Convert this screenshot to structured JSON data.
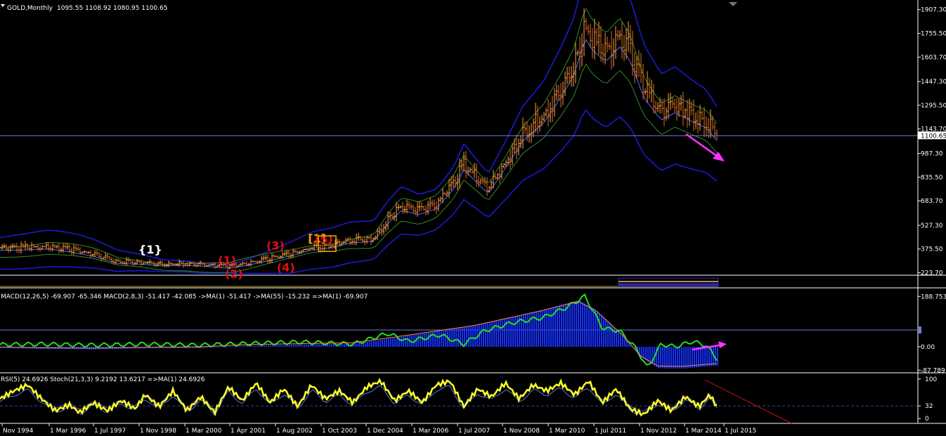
{
  "header": {
    "symbol": "GOLD,Monthly",
    "ohlc": "1095.55 1108.92 1080.95 1100.65"
  },
  "colors": {
    "background": "#000000",
    "grid": "#ffffff",
    "candle_up": "#ffa040",
    "candle_down": "#e07020",
    "band_outer": "#1a1ad0",
    "band_inner": "#2e8b2e",
    "ma_line": "#4a6cff",
    "current_price_line": "#6c7cd8",
    "arrow": "#ff33ff",
    "macd_hist": "#1530ff",
    "macd_line": "#22e022",
    "rsi_line": "#ffff22",
    "stoch_line": "#7a5cc8",
    "wave_red": "#e01010",
    "wave_orange": "#ffa500",
    "wave_white": "#ffffff",
    "trendline": "#c01010"
  },
  "chart_data": [
    {
      "type": "ohlc",
      "title": "GOLD,Monthly",
      "x_ticks": [
        "Nov 1994",
        "1 Mar 1996",
        "1 Jul 1997",
        "1 Nov 1998",
        "1 Mar 2000",
        "1 Apr 2001",
        "1 Aug 2002",
        "1 Oct 2003",
        "1 Dec 2004",
        "1 Mar 2006",
        "1 Jul 2007",
        "1 Nov 2008",
        "1 Mar 2010",
        "1 Jul 2011",
        "1 Nov 2012",
        "1 Mar 2014",
        "1 Jul 2015"
      ],
      "y_ticks": [
        1907.3,
        1755.5,
        1603.7,
        1447.3,
        1295.5,
        1143.7,
        987.3,
        835.5,
        683.7,
        527.3,
        375.5,
        223.7
      ],
      "y_tick_labels": [
        "1907.30",
        "1755.50",
        "1603.70",
        "1447.30",
        "1295.50",
        "1143.70",
        "987.30",
        "835.50",
        "683.70",
        "527.30",
        "375.50",
        "223.70"
      ],
      "ylim": [
        208,
        1942
      ],
      "current_price": 1100.65,
      "current_price_label": "1100.65",
      "price_series": [
        [
          1994.8,
          383
        ],
        [
          1995.5,
          385
        ],
        [
          1996.2,
          392
        ],
        [
          1996.9,
          370
        ],
        [
          1997.5,
          342
        ],
        [
          1998.2,
          295
        ],
        [
          1998.9,
          290
        ],
        [
          1999.5,
          278
        ],
        [
          2000.2,
          283
        ],
        [
          2000.9,
          272
        ],
        [
          2001.4,
          262
        ],
        [
          2002.0,
          285
        ],
        [
          2002.6,
          315
        ],
        [
          2003.2,
          345
        ],
        [
          2003.8,
          385
        ],
        [
          2004.4,
          400
        ],
        [
          2004.9,
          430
        ],
        [
          2005.6,
          445
        ],
        [
          2006.0,
          560
        ],
        [
          2006.4,
          650
        ],
        [
          2006.9,
          620
        ],
        [
          2007.4,
          660
        ],
        [
          2007.9,
          790
        ],
        [
          2008.2,
          920
        ],
        [
          2008.6,
          830
        ],
        [
          2008.9,
          760
        ],
        [
          2009.4,
          930
        ],
        [
          2009.9,
          1110
        ],
        [
          2010.5,
          1230
        ],
        [
          2011.0,
          1400
        ],
        [
          2011.4,
          1560
        ],
        [
          2011.7,
          1800
        ],
        [
          2011.9,
          1720
        ],
        [
          2012.3,
          1640
        ],
        [
          2012.7,
          1740
        ],
        [
          2013.0,
          1650
        ],
        [
          2013.4,
          1400
        ],
        [
          2013.9,
          1250
        ],
        [
          2014.3,
          1300
        ],
        [
          2014.8,
          1240
        ],
        [
          2015.2,
          1200
        ],
        [
          2015.55,
          1100.65
        ]
      ]
    },
    {
      "type": "line",
      "title": "MACD(12,26,5) -69.907 -65.346  MACD(2,8,3) -51.417 -42.085  ->MA(1) -51.417  ->MA(55) -15.232  =>MA(1) -69.907",
      "y_ticks": [
        188.753,
        0.0,
        -87.789
      ],
      "y_tick_labels": [
        "188.753",
        "0.00",
        "-87.789"
      ],
      "ylim": [
        -95,
        200
      ],
      "histogram": [
        [
          1994.8,
          -5
        ],
        [
          1996.0,
          -8
        ],
        [
          1997.5,
          -10
        ],
        [
          1999.0,
          -6
        ],
        [
          2000.5,
          -5
        ],
        [
          2002.0,
          5
        ],
        [
          2003.5,
          8
        ],
        [
          2005.0,
          12
        ],
        [
          2006.5,
          40
        ],
        [
          2007.5,
          60
        ],
        [
          2008.5,
          80
        ],
        [
          2009.5,
          110
        ],
        [
          2010.5,
          140
        ],
        [
          2011.5,
          175
        ],
        [
          2012.0,
          140
        ],
        [
          2012.8,
          40
        ],
        [
          2013.3,
          -40
        ],
        [
          2013.8,
          -80
        ],
        [
          2014.5,
          -82
        ],
        [
          2015.55,
          -70
        ]
      ],
      "signal_line": [
        [
          1994.8,
          8
        ],
        [
          1996.0,
          10
        ],
        [
          1997.5,
          6
        ],
        [
          1999.0,
          10
        ],
        [
          2000.5,
          6
        ],
        [
          2002.0,
          12
        ],
        [
          2003.5,
          18
        ],
        [
          2005.0,
          10
        ],
        [
          2006.0,
          50
        ],
        [
          2006.6,
          20
        ],
        [
          2007.5,
          45
        ],
        [
          2008.2,
          10
        ],
        [
          2008.8,
          60
        ],
        [
          2009.6,
          90
        ],
        [
          2010.5,
          110
        ],
        [
          2011.2,
          150
        ],
        [
          2011.7,
          190
        ],
        [
          2012.2,
          70
        ],
        [
          2012.7,
          60
        ],
        [
          2013.2,
          -10
        ],
        [
          2013.5,
          -80
        ],
        [
          2013.9,
          10
        ],
        [
          2014.3,
          0
        ],
        [
          2014.8,
          20
        ],
        [
          2015.2,
          5
        ],
        [
          2015.55,
          -51.417
        ]
      ]
    },
    {
      "type": "line",
      "title": "RSI(5) 24.6926  Stoch(21,3,3) 9.2192 13.6217  =>MA(1) 24.6926",
      "y_ticks": [
        100,
        32,
        0
      ],
      "y_tick_labels": [
        "100",
        "32",
        "0"
      ],
      "ylim": [
        -5,
        105
      ],
      "rsi_series": [
        [
          1994.8,
          50
        ],
        [
          1995.2,
          70
        ],
        [
          1995.6,
          85
        ],
        [
          1996.0,
          50
        ],
        [
          1996.4,
          20
        ],
        [
          1996.8,
          35
        ],
        [
          1997.1,
          15
        ],
        [
          1997.5,
          40
        ],
        [
          1997.9,
          20
        ],
        [
          1998.3,
          45
        ],
        [
          1998.7,
          25
        ],
        [
          1999.0,
          60
        ],
        [
          1999.4,
          30
        ],
        [
          1999.8,
          70
        ],
        [
          2000.2,
          20
        ],
        [
          2000.6,
          55
        ],
        [
          2001.0,
          15
        ],
        [
          2001.4,
          80
        ],
        [
          2001.8,
          45
        ],
        [
          2002.2,
          90
        ],
        [
          2002.6,
          40
        ],
        [
          2003.0,
          75
        ],
        [
          2003.4,
          30
        ],
        [
          2003.8,
          85
        ],
        [
          2004.2,
          50
        ],
        [
          2004.6,
          70
        ],
        [
          2005.0,
          40
        ],
        [
          2005.4,
          80
        ],
        [
          2005.8,
          95
        ],
        [
          2006.2,
          45
        ],
        [
          2006.6,
          70
        ],
        [
          2007.0,
          40
        ],
        [
          2007.4,
          85
        ],
        [
          2007.8,
          95
        ],
        [
          2008.2,
          30
        ],
        [
          2008.6,
          75
        ],
        [
          2009.0,
          55
        ],
        [
          2009.4,
          90
        ],
        [
          2009.8,
          50
        ],
        [
          2010.2,
          85
        ],
        [
          2010.6,
          70
        ],
        [
          2011.0,
          90
        ],
        [
          2011.4,
          60
        ],
        [
          2011.8,
          95
        ],
        [
          2012.2,
          40
        ],
        [
          2012.6,
          75
        ],
        [
          2013.0,
          25
        ],
        [
          2013.4,
          10
        ],
        [
          2013.8,
          45
        ],
        [
          2014.2,
          20
        ],
        [
          2014.6,
          55
        ],
        [
          2015.0,
          30
        ],
        [
          2015.3,
          60
        ],
        [
          2015.55,
          24.6926
        ]
      ]
    }
  ],
  "wave_labels": [
    {
      "text": "{1}",
      "color": "white",
      "year": 1999.0,
      "price": 375
    },
    {
      "text": "(1)",
      "color": "red",
      "year": 2001.3,
      "price": 305
    },
    {
      "text": "(2)",
      "color": "red",
      "year": 2001.5,
      "price": 220
    },
    {
      "text": "(3)",
      "color": "red",
      "year": 2002.7,
      "price": 400
    },
    {
      "text": "(4)",
      "color": "red",
      "year": 2003.0,
      "price": 260
    },
    {
      "text": "[1]",
      "color": "orange",
      "year": 2003.9,
      "price": 445
    },
    {
      "text": "(5)",
      "color": "red",
      "year": 2004.1,
      "price": 440
    }
  ]
}
